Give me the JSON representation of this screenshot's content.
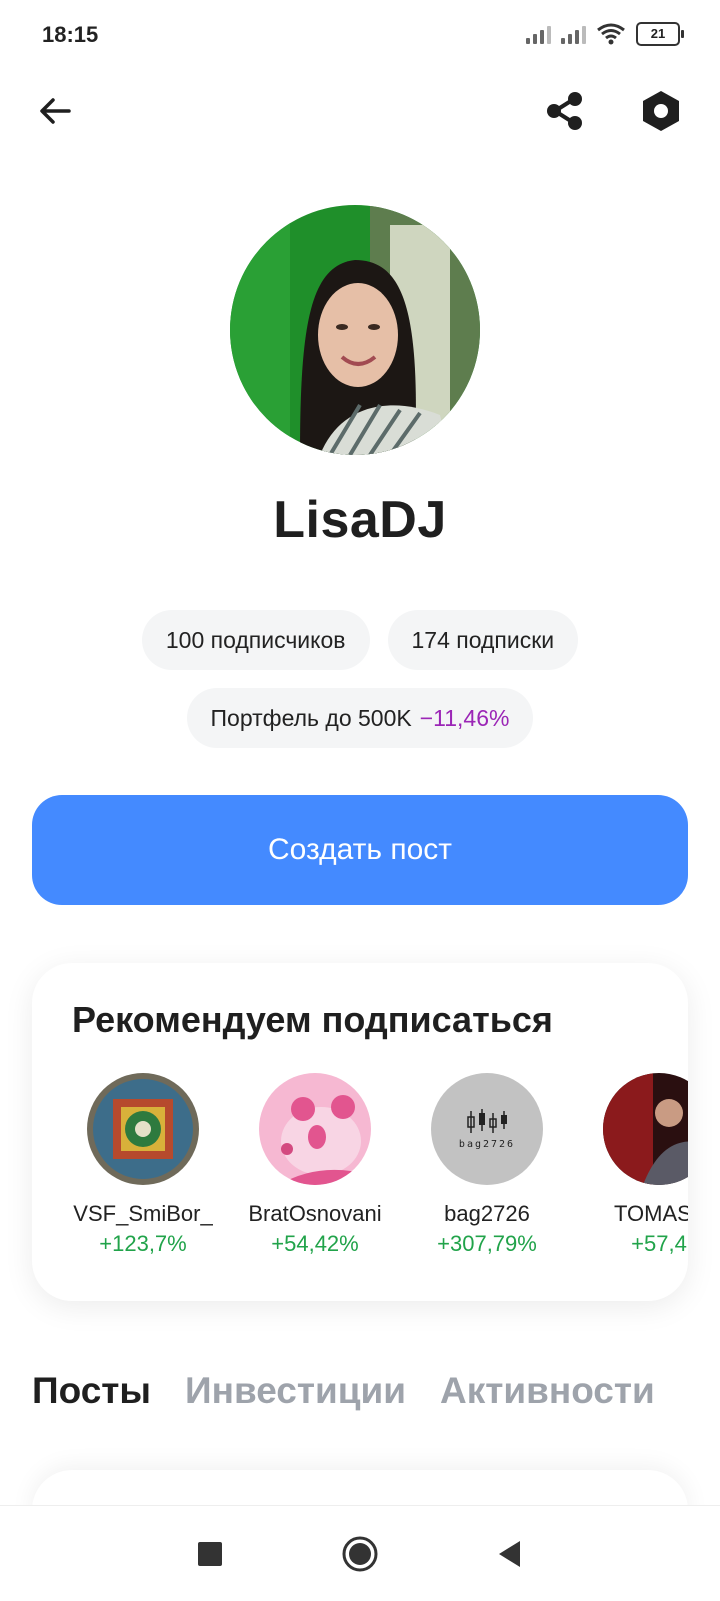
{
  "status_bar": {
    "time": "18:15",
    "battery": "21",
    "icons": [
      "signal-icon",
      "signal-icon",
      "wifi-icon",
      "battery-icon"
    ]
  },
  "top_bar": {
    "icons": [
      "back-arrow-icon",
      "share-icon",
      "settings-icon"
    ]
  },
  "profile": {
    "username": "LisaDJ",
    "followers": "100 подписчиков",
    "following": "174 подписки",
    "portfolio_label": "Портфель до 500K",
    "portfolio_change": "−11,46%",
    "portfolio_change_color": "#9b26b6"
  },
  "actions": {
    "create_post": "Создать пост",
    "accent_color": "#448aff"
  },
  "recommend": {
    "title": "Рекомендуем подписаться",
    "items": [
      {
        "name": "VSF_SmiBor_",
        "gain": "+123,7%"
      },
      {
        "name": "BratOsnovani",
        "gain": "+54,42%"
      },
      {
        "name": "bag2726",
        "gain": "+307,79%",
        "avatar_text": "bag2726"
      },
      {
        "name": "TOMAS_",
        "gain": "+57,4"
      }
    ],
    "gain_color": "#21a34a"
  },
  "tabs": [
    {
      "label": "Посты",
      "active": true
    },
    {
      "label": "Инвестиции",
      "active": false
    },
    {
      "label": "Активности",
      "active": false
    }
  ]
}
